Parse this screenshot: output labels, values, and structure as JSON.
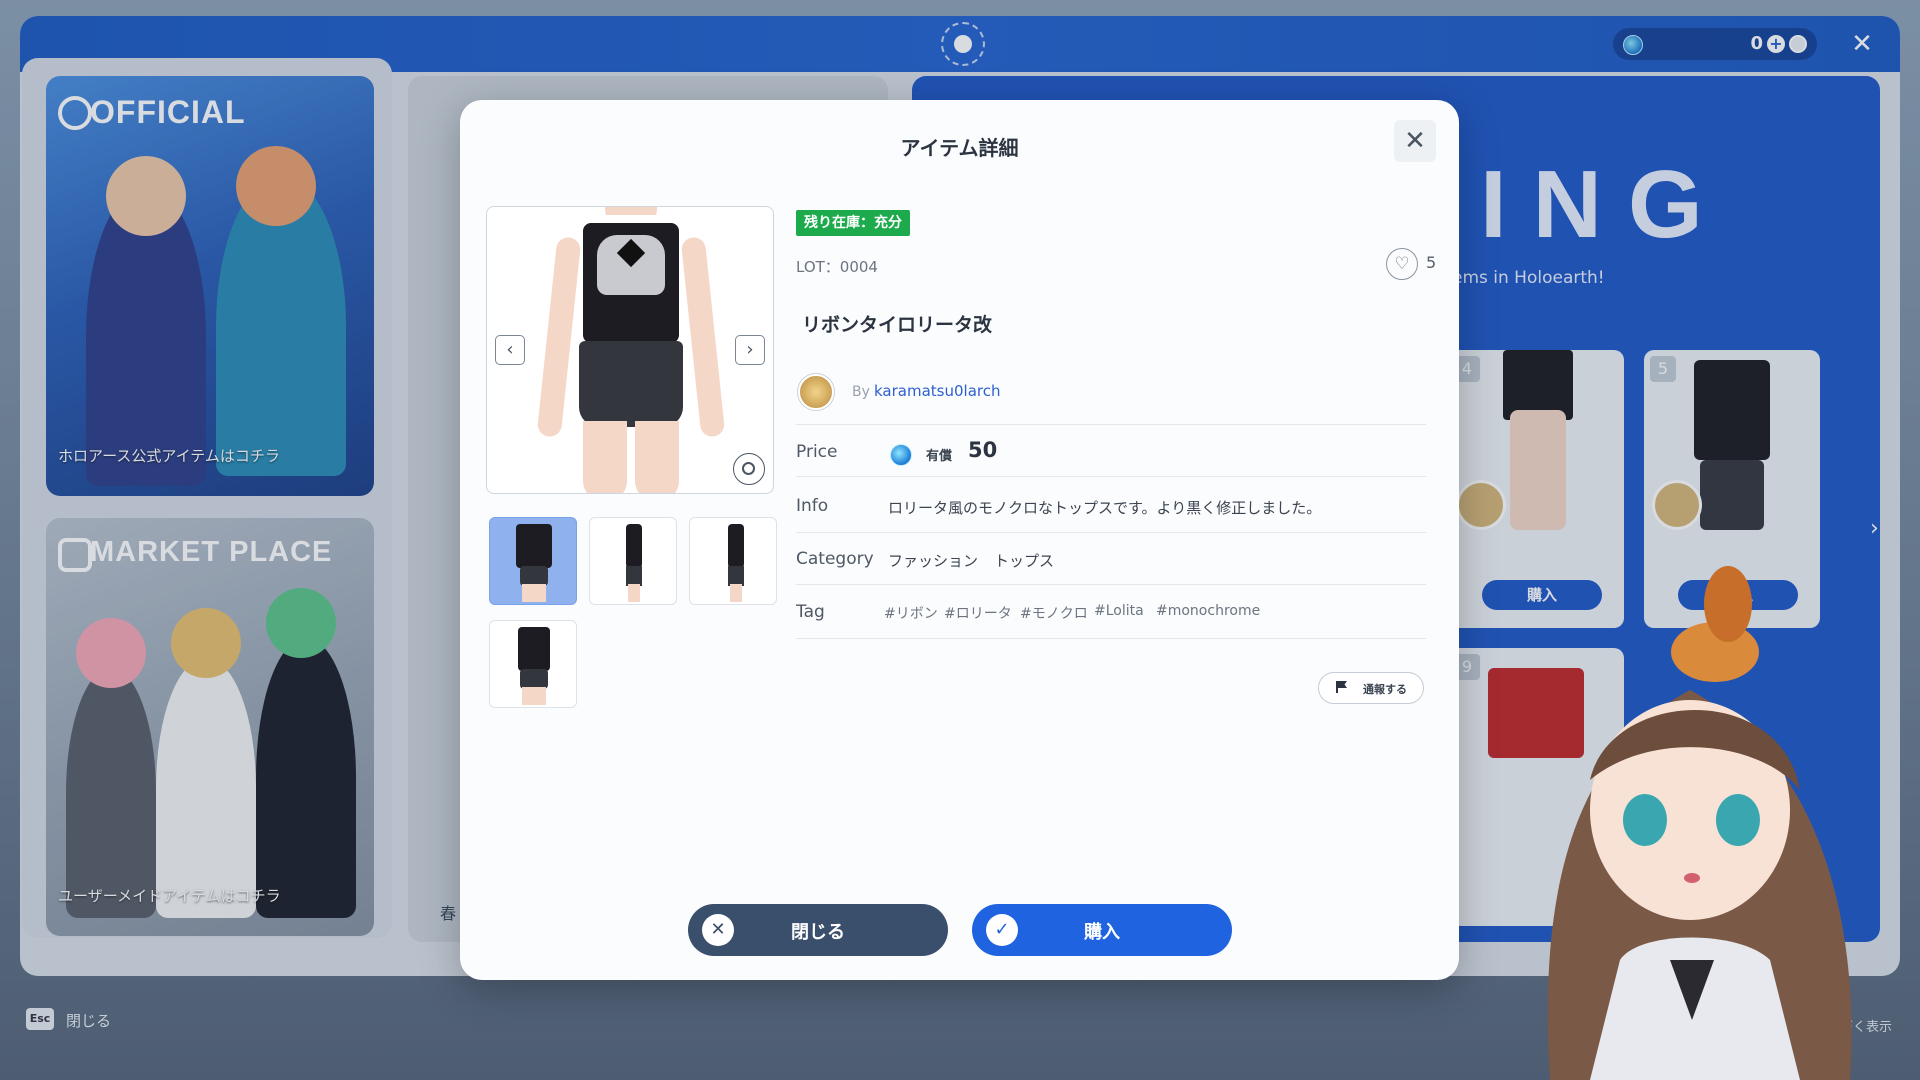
{
  "topbar": {
    "currency_value": "0"
  },
  "banners": {
    "official": {
      "title": "OFFICIAL",
      "caption": "ホロアース公式アイテムはコチラ"
    },
    "market": {
      "title": "MARKET PLACE",
      "caption": "ユーザーメイドアイテムはコチラ"
    }
  },
  "middle_panel": {
    "partial_text": "春"
  },
  "ranking": {
    "title": "ING",
    "subtitle": "ems in Holoearth!",
    "cards": [
      {
        "rank": "4",
        "buy_label": "購入"
      },
      {
        "rank": "5",
        "buy_label": "購入"
      },
      {
        "rank": "9"
      }
    ]
  },
  "footer": {
    "esc_key": "Esc",
    "esc_label": "閉じる",
    "right_hint": "に基づく表示"
  },
  "modal": {
    "title": "アイテム詳細",
    "stock_badge": "残り在庫：充分",
    "lot": "LOT：0004",
    "favorites": "5",
    "item_name": "リボンタイロリータ改",
    "creator": {
      "by": "By",
      "name": "karamatsu0larch"
    },
    "price": {
      "label": "Price",
      "type": "有償",
      "value": "50"
    },
    "info": {
      "label": "Info",
      "text": "ロリータ風のモノクロなトップスです。より黒く修正しました。"
    },
    "category": {
      "label": "Category",
      "values": [
        "ファッション",
        "トップス"
      ]
    },
    "tag": {
      "label": "Tag",
      "values": [
        "#リボン",
        "#ロリータ",
        "#モノクロ",
        "#Lolita",
        "#monochrome"
      ]
    },
    "report_label": "通報する",
    "close_label": "閉じる",
    "buy_label": "購入"
  },
  "colors": {
    "primary": "#1f63e0",
    "accent_green": "#1daa4c",
    "topbar": "#1d5bc3"
  }
}
